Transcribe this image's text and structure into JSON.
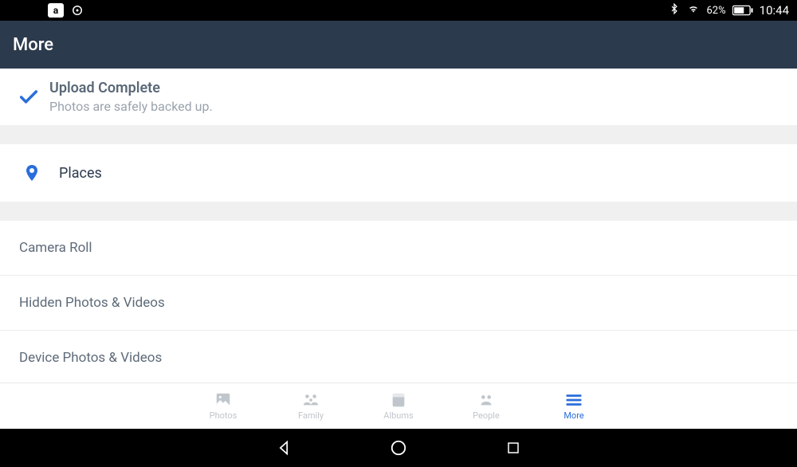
{
  "status": {
    "battery_pct": "62%",
    "time": "10:44"
  },
  "header": {
    "title": "More"
  },
  "upload": {
    "title": "Upload Complete",
    "subtitle": "Photos are safely backed up."
  },
  "places": {
    "label": "Places"
  },
  "list": {
    "items": [
      {
        "label": "Camera Roll"
      },
      {
        "label": "Hidden Photos & Videos"
      },
      {
        "label": "Device Photos & Videos"
      }
    ]
  },
  "tabs": {
    "photos": "Photos",
    "family": "Family",
    "albums": "Albums",
    "people": "People",
    "more": "More"
  }
}
